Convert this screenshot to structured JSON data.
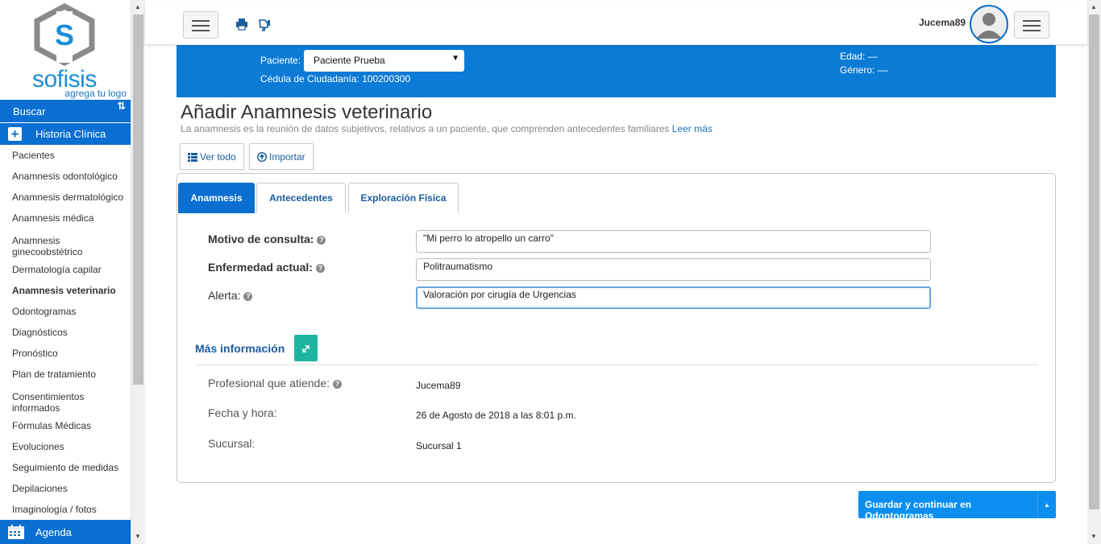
{
  "brand": {
    "name": "sofisis",
    "tagline": "agrega tu logo",
    "color": "#1a8fd6"
  },
  "sidebar": {
    "search_label": "Buscar",
    "section_label": "Historia Clínica",
    "items": [
      {
        "label": "Pacientes",
        "active": false
      },
      {
        "label": "Anamnesis odontológico",
        "active": false
      },
      {
        "label": "Anamnesis dermatológico",
        "active": false
      },
      {
        "label": "Anamnesis médica",
        "active": false
      },
      {
        "label": "Anamnesis ginecoobstétrico",
        "active": false
      },
      {
        "label": "Dermatología capilar",
        "active": false
      },
      {
        "label": "Anamnesis veterinario",
        "active": true
      },
      {
        "label": "Odontogramas",
        "active": false
      },
      {
        "label": "Diagnósticos",
        "active": false
      },
      {
        "label": "Pronóstico",
        "active": false
      },
      {
        "label": "Plan de tratamiento",
        "active": false
      },
      {
        "label": "Consentimientos informados",
        "active": false
      },
      {
        "label": "Fórmulas Médicas",
        "active": false
      },
      {
        "label": "Evoluciones",
        "active": false
      },
      {
        "label": "Seguimiento de medidas",
        "active": false
      },
      {
        "label": "Depilaciones",
        "active": false
      },
      {
        "label": "Imaginología / fotos",
        "active": false
      }
    ],
    "agenda_label": "Agenda"
  },
  "topbar": {
    "username": "Jucema89"
  },
  "patient": {
    "label": "Paciente:",
    "selected": "Paciente Prueba",
    "cedula": "Cédula de Ciudadanía: 100200300",
    "edad": "Edad: —",
    "genero": "Género: ––"
  },
  "page": {
    "title": "Añadir Anamnesis veterinario",
    "subtitle": "La anamnesis es la reunión de datos subjetivos, relativos a un paciente, que comprenden antecedentes familiares",
    "more_link": "Leer más",
    "ver_todo": "Ver todo",
    "importar": "Importar"
  },
  "tabs": [
    {
      "label": "Anamnesis",
      "active": true
    },
    {
      "label": "Antecedentes",
      "active": false
    },
    {
      "label": "Exploración Física",
      "active": false
    }
  ],
  "form": {
    "motivo_label": "Motivo de consulta:",
    "motivo_value": "\"Mi perro lo atropello un carro\"",
    "enfermedad_label": "Enfermedad actual:",
    "enfermedad_value": "Politraumatismo",
    "alerta_label": "Alerta:",
    "alerta_value": "Valoración por cirugía de Urgencias"
  },
  "more_info": {
    "title": "Más información",
    "profesional_label": "Profesional que atiende:",
    "profesional_value": "Jucema89",
    "fecha_label": "Fecha y hora:",
    "fecha_value": "26 de Agosto de 2018 a las 8:01 p.m.",
    "sucursal_label": "Sucursal:",
    "sucursal_value": "Sucursal 1"
  },
  "actions": {
    "save_label": "Guardar y continuar en Odontogramas"
  },
  "colors": {
    "primary": "#0b6fd1",
    "header": "#0b7bd6",
    "save": "#0b8ef0",
    "expand": "#1db5a0"
  }
}
